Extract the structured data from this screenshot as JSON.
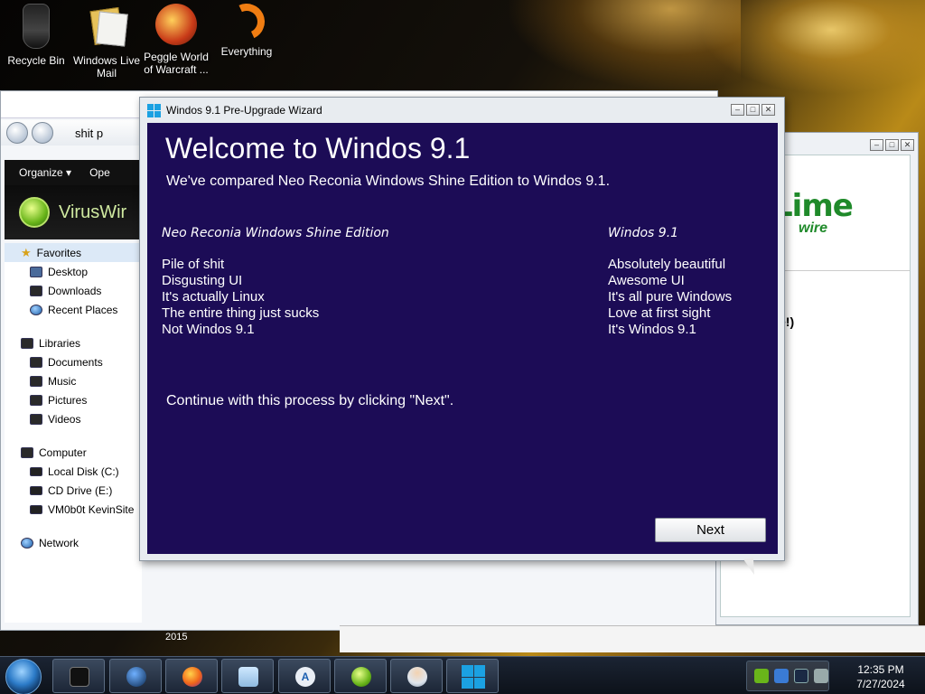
{
  "desktop": {
    "icons": [
      {
        "label": "Recycle Bin"
      },
      {
        "label": "Windows Live Mail"
      },
      {
        "label": "Peggle World of Warcraft ..."
      },
      {
        "label": "Everything"
      }
    ]
  },
  "explorer": {
    "address": "shit p",
    "toolbar": {
      "organize": "Organize ▾",
      "open": "Ope"
    },
    "brand": "VirusWir",
    "nav": {
      "favorites": {
        "label": "Favorites",
        "items": [
          "Desktop",
          "Downloads",
          "Recent Places"
        ]
      },
      "libraries": {
        "label": "Libraries",
        "items": [
          "Documents",
          "Music",
          "Pictures",
          "Videos"
        ]
      },
      "computer": {
        "label": "Computer",
        "items": [
          "Local Disk (C:)",
          "CD Drive (E:)",
          "VM0b0t KevinSite"
        ]
      },
      "network": {
        "label": "Network"
      }
    },
    "year_label": "2015"
  },
  "limewire": {
    "logo": "Lime",
    "sub": "wire",
    "text": "e!)"
  },
  "wizard": {
    "title": "Windos 9.1 Pre-Upgrade Wizard",
    "heading": "Welcome to Windos 9.1",
    "subheading": "We've compared Neo Reconia Windows Shine Edition  to Windos 9.1.",
    "left_column": {
      "header": "Neo Reconia Windows Shine Edition",
      "items": [
        "Pile of shit",
        "Disgusting UI",
        "It's actually Linux",
        "The entire thing just sucks",
        "Not Windos 9.1"
      ]
    },
    "right_column": {
      "header": "Windos 9.1",
      "items": [
        "Absolutely beautiful",
        "Awesome UI",
        "It's all pure Windows",
        "Love at first sight",
        "It's Windos 9.1"
      ]
    },
    "continue_text": "Continue with this process by clicking \"Next\".",
    "next_label": "Next"
  },
  "taskbar": {
    "clock": {
      "time": "12:35 PM",
      "date": "7/27/2024"
    }
  },
  "colors": {
    "wizard_bg": "#1c0c56",
    "windows_blue": "#1ba1e2",
    "lime_green": "#1f8a2a"
  }
}
